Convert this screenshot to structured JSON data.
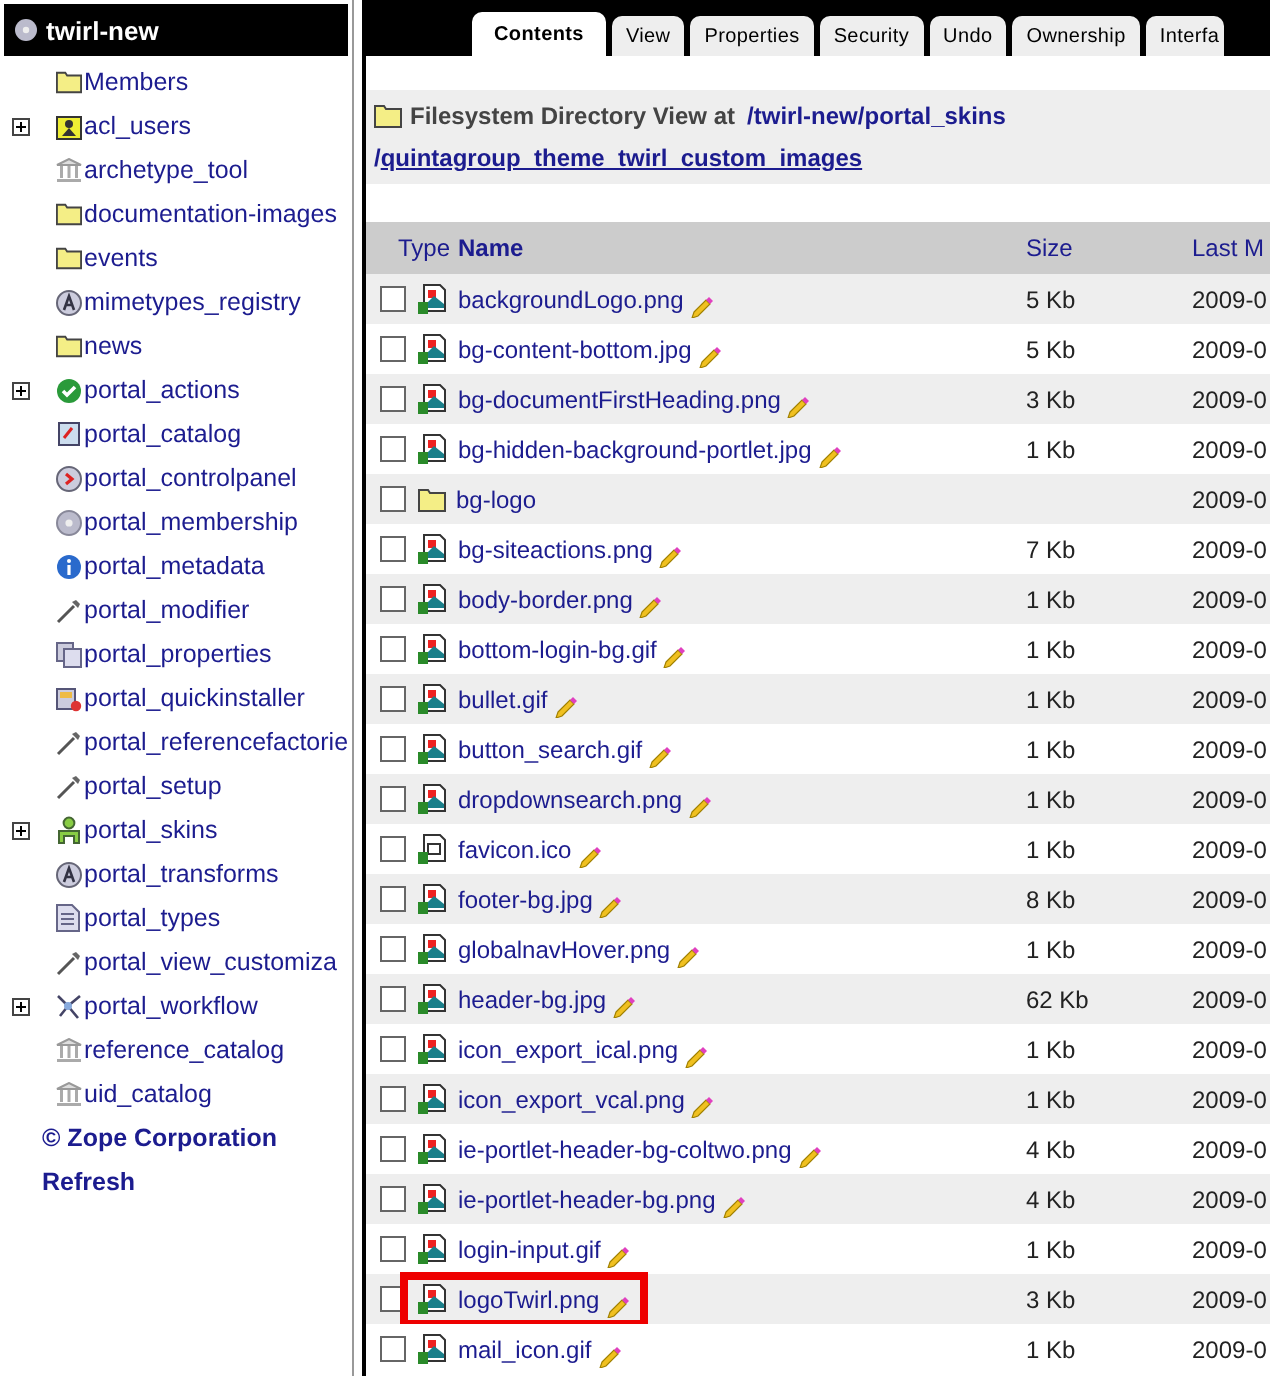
{
  "tree": {
    "root": "twirl-new",
    "items": [
      {
        "label": "Members",
        "kind": "folder",
        "expandable": false
      },
      {
        "label": "acl_users",
        "kind": "users",
        "expandable": true
      },
      {
        "label": "archetype_tool",
        "kind": "columns",
        "expandable": false
      },
      {
        "label": "documentation-images",
        "kind": "folder",
        "expandable": false
      },
      {
        "label": "events",
        "kind": "folder",
        "expandable": false
      },
      {
        "label": "mimetypes_registry",
        "kind": "letter",
        "expandable": false
      },
      {
        "label": "news",
        "kind": "folder",
        "expandable": false
      },
      {
        "label": "portal_actions",
        "kind": "check",
        "expandable": true
      },
      {
        "label": "portal_catalog",
        "kind": "catalog",
        "expandable": false
      },
      {
        "label": "portal_controlpanel",
        "kind": "control",
        "expandable": false
      },
      {
        "label": "portal_membership",
        "kind": "disc",
        "expandable": false
      },
      {
        "label": "portal_metadata",
        "kind": "info",
        "expandable": false
      },
      {
        "label": "portal_modifier",
        "kind": "wrench",
        "expandable": false
      },
      {
        "label": "portal_properties",
        "kind": "pages",
        "expandable": false
      },
      {
        "label": "portal_quickinstaller",
        "kind": "installer",
        "expandable": false
      },
      {
        "label": "portal_referencefactorie",
        "kind": "wrench",
        "expandable": false
      },
      {
        "label": "portal_setup",
        "kind": "wrench",
        "expandable": false
      },
      {
        "label": "portal_skins",
        "kind": "skins",
        "expandable": true
      },
      {
        "label": "portal_transforms",
        "kind": "letter",
        "expandable": false
      },
      {
        "label": "portal_types",
        "kind": "document",
        "expandable": false
      },
      {
        "label": "portal_view_customiza",
        "kind": "wrench",
        "expandable": false
      },
      {
        "label": "portal_workflow",
        "kind": "workflow",
        "expandable": true
      },
      {
        "label": "reference_catalog",
        "kind": "columns",
        "expandable": false
      },
      {
        "label": "uid_catalog",
        "kind": "columns",
        "expandable": false
      }
    ],
    "footer_links": [
      "© Zope Corporation",
      "Refresh"
    ]
  },
  "tabs": [
    {
      "label": "Contents",
      "selected": true
    },
    {
      "label": "View",
      "selected": false
    },
    {
      "label": "Properties",
      "selected": false
    },
    {
      "label": "Security",
      "selected": false
    },
    {
      "label": "Undo",
      "selected": false
    },
    {
      "label": "Ownership",
      "selected": false
    },
    {
      "label": "Interfa",
      "selected": false
    }
  ],
  "heading": {
    "title": "Filesystem Directory View at",
    "path_lines": [
      [
        {
          "sep": "/",
          "link": "twirl-new"
        },
        {
          "sep": "/",
          "link": "portal_skins"
        }
      ],
      [
        {
          "sep": "/",
          "link": "quintagroup_theme_twirl_custom_images"
        }
      ]
    ]
  },
  "table": {
    "columns": [
      "Type",
      "Name",
      "Size",
      "Last M"
    ],
    "rows": [
      {
        "kind": "image",
        "name": "backgroundLogo.png",
        "size": "5 Kb",
        "date": "2009-0",
        "checked": false,
        "outlined": false
      },
      {
        "kind": "image",
        "name": "bg-content-bottom.jpg",
        "size": "5 Kb",
        "date": "2009-0",
        "checked": false,
        "outlined": false
      },
      {
        "kind": "image",
        "name": "bg-documentFirstHeading.png",
        "size": "3 Kb",
        "date": "2009-0",
        "checked": false,
        "outlined": false
      },
      {
        "kind": "image",
        "name": "bg-hidden-background-portlet.jpg",
        "size": "1 Kb",
        "date": "2009-0",
        "checked": false,
        "outlined": false
      },
      {
        "kind": "folder",
        "name": "bg-logo",
        "date": "2009-0",
        "checked": false,
        "outlined": false
      },
      {
        "kind": "image",
        "name": "bg-siteactions.png",
        "size": "7 Kb",
        "date": "2009-0",
        "checked": false,
        "outlined": false
      },
      {
        "kind": "image",
        "name": "body-border.png",
        "size": "1 Kb",
        "date": "2009-0",
        "checked": false,
        "outlined": false
      },
      {
        "kind": "image",
        "name": "bottom-login-bg.gif",
        "size": "1 Kb",
        "date": "2009-0",
        "checked": false,
        "outlined": false
      },
      {
        "kind": "image",
        "name": "bullet.gif",
        "size": "1 Kb",
        "date": "2009-0",
        "checked": false,
        "outlined": false
      },
      {
        "kind": "image",
        "name": "button_search.gif",
        "size": "1 Kb",
        "date": "2009-0",
        "checked": false,
        "outlined": false
      },
      {
        "kind": "image",
        "name": "dropdownsearch.png",
        "size": "1 Kb",
        "date": "2009-0",
        "checked": false,
        "outlined": false
      },
      {
        "kind": "file",
        "name": "favicon.ico",
        "size": "1 Kb",
        "date": "2009-0",
        "checked": false,
        "outlined": false
      },
      {
        "kind": "image",
        "name": "footer-bg.jpg",
        "size": "8 Kb",
        "date": "2009-0",
        "checked": false,
        "outlined": false
      },
      {
        "kind": "image",
        "name": "globalnavHover.png",
        "size": "1 Kb",
        "date": "2009-0",
        "checked": false,
        "outlined": false
      },
      {
        "kind": "image",
        "name": "header-bg.jpg",
        "size": "62 Kb",
        "date": "2009-0",
        "checked": false,
        "outlined": false
      },
      {
        "kind": "image",
        "name": "icon_export_ical.png",
        "size": "1 Kb",
        "date": "2009-0",
        "checked": false,
        "outlined": false
      },
      {
        "kind": "image",
        "name": "icon_export_vcal.png",
        "size": "1 Kb",
        "date": "2009-0",
        "checked": false,
        "outlined": false
      },
      {
        "kind": "image",
        "name": "ie-portlet-header-bg-coltwo.png",
        "size": "4 Kb",
        "date": "2009-0",
        "checked": false,
        "outlined": false
      },
      {
        "kind": "image",
        "name": "ie-portlet-header-bg.png",
        "size": "4 Kb",
        "date": "2009-0",
        "checked": false,
        "outlined": false
      },
      {
        "kind": "image",
        "name": "login-input.gif",
        "size": "1 Kb",
        "date": "2009-0",
        "checked": false,
        "outlined": false
      },
      {
        "kind": "image",
        "name": "logoTwirl.png",
        "size": "3 Kb",
        "date": "2009-0",
        "checked": false,
        "outlined": true
      },
      {
        "kind": "image",
        "name": "mail_icon.gif",
        "size": "1 Kb",
        "date": "2009-0",
        "checked": false,
        "outlined": false
      }
    ]
  }
}
